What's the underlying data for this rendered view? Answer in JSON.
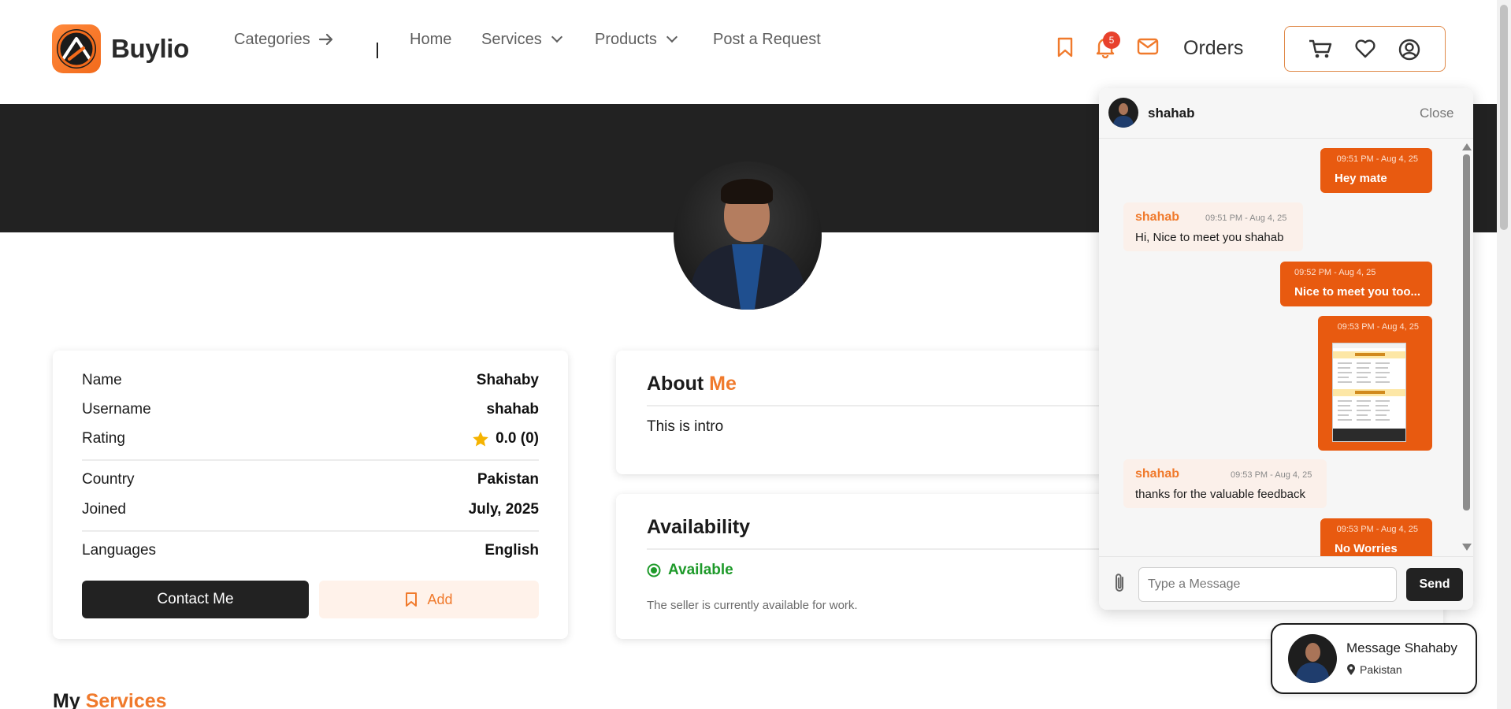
{
  "brand": {
    "name": "Buylio"
  },
  "nav": {
    "categories": "Categories",
    "separator": "|",
    "home": "Home",
    "services": "Services",
    "products": "Products",
    "post_request": "Post a Request"
  },
  "header": {
    "notification_count": "5",
    "orders": "Orders"
  },
  "colors": {
    "accent": "#f07a2c",
    "dark": "#222222",
    "message_out": "#e85a10",
    "available": "#1e9a2a"
  },
  "profile": {
    "rows": [
      {
        "label": "Name",
        "value": "Shahaby"
      },
      {
        "label": "Username",
        "value": "shahab"
      },
      {
        "label": "Rating",
        "value": "0.0 (0)"
      },
      {
        "label": "Country",
        "value": "Pakistan"
      },
      {
        "label": "Joined",
        "value": "July, 2025"
      },
      {
        "label": "Languages",
        "value": "English"
      }
    ],
    "contact_label": "Contact Me",
    "add_label": "Add"
  },
  "about": {
    "title_main": "About",
    "title_accent": "Me",
    "text": "This is intro"
  },
  "availability": {
    "title": "Availability",
    "status": "Available",
    "note": "The seller is currently available for work."
  },
  "services_section": {
    "title_main": "My",
    "title_accent": "Services"
  },
  "chat": {
    "name": "shahab",
    "close_label": "Close",
    "messages": [
      {
        "dir": "out",
        "time": "09:51 PM - Aug 4, 25",
        "text": "Hey mate"
      },
      {
        "dir": "in",
        "sender": "shahab",
        "time": "09:51 PM - Aug 4, 25",
        "text": "Hi, Nice to meet you shahab"
      },
      {
        "dir": "out",
        "time": "09:52 PM - Aug 4, 25",
        "text": "Nice to meet you too..."
      },
      {
        "dir": "out",
        "time": "09:53 PM - Aug 4, 25",
        "text": ""
      },
      {
        "dir": "in",
        "sender": "shahab",
        "time": "09:53 PM - Aug 4, 25",
        "text": "thanks for the valuable feedback"
      },
      {
        "dir": "out",
        "time": "09:53 PM - Aug 4, 25",
        "text": "No Worries"
      }
    ],
    "input_placeholder": "Type a Message",
    "send_label": "Send"
  },
  "float_card": {
    "title": "Message Shahaby",
    "location": "Pakistan"
  }
}
